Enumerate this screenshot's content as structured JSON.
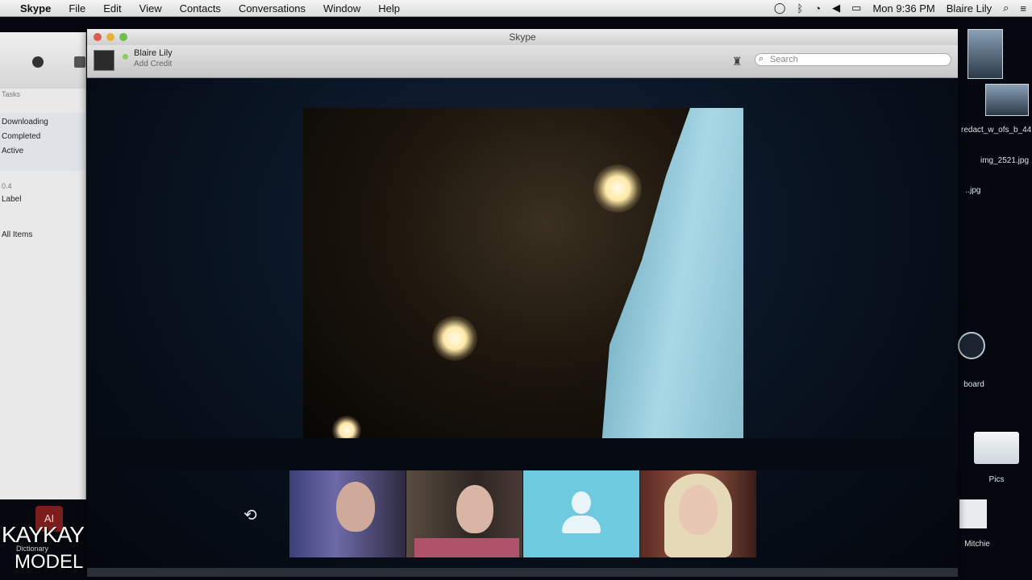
{
  "menubar": {
    "app_name": "Skype",
    "items": [
      "File",
      "Edit",
      "View",
      "Contacts",
      "Conversations",
      "Window",
      "Help"
    ],
    "clock": "Mon 9:36 PM",
    "user": "Blaire Lily"
  },
  "bg_app": {
    "section1": "Tasks",
    "rows1": [
      "Downloading",
      "Completed",
      "Active"
    ],
    "section2": "0.4",
    "label": "Label",
    "all_items": "All Items"
  },
  "desktop": {
    "file1": "img_2521.jpg",
    "file2": "redact_w_ofs_b_44.JPG",
    "file3": "..jpg",
    "item_board": "board",
    "folder_pics": "Pics",
    "folder_mitchie": "Mitchie"
  },
  "skype": {
    "window_title": "Skype",
    "user_name": "Blaire Lily",
    "user_status": "Add Credit",
    "search_placeholder": "Search",
    "participants": [
      "participant-1",
      "participant-2",
      "participant-3-no-video",
      "participant-4"
    ]
  },
  "watermark": {
    "badge": "AI",
    "line1": "KAYKAY",
    "line2": "Dictionary",
    "line3": "MODEL"
  },
  "colors": {
    "call_background": "#0a1626",
    "placeholder_tile": "#6ecbdf"
  }
}
